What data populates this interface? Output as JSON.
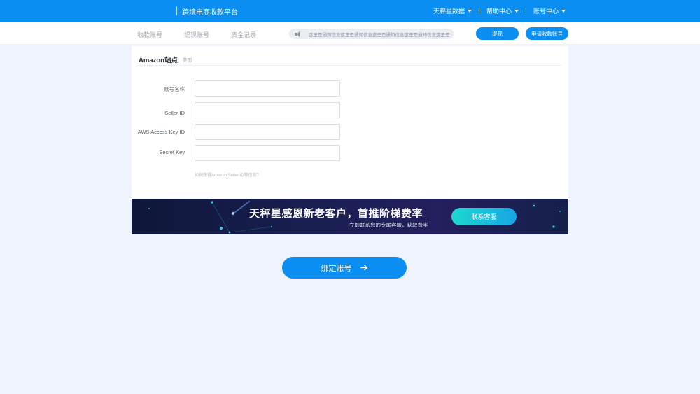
{
  "header": {
    "brand": "跨境电商收款平台",
    "nav": [
      {
        "label": "天秤星数据"
      },
      {
        "label": "帮助中心"
      },
      {
        "label": "账号中心"
      }
    ]
  },
  "subnav": {
    "tabs": [
      "收款账号",
      "提现账号",
      "资金记录"
    ],
    "notice": "这里是通知信息这里是通知信息这里是通知信息这里是通知信息这里是",
    "withdraw_label": "提现",
    "apply_label": "申请收款账号"
  },
  "form": {
    "title": "Amazon站点",
    "region": "美国",
    "fields": [
      {
        "label": "账号名称",
        "value": ""
      },
      {
        "label": "Seller ID",
        "value": ""
      },
      {
        "label": "AWS Access Key ID",
        "value": ""
      },
      {
        "label": "Secret Key",
        "value": ""
      }
    ],
    "help": "如何获得Amazon Seller ID等信息？"
  },
  "banner": {
    "title": "天秤星感恩新老客户，首推阶梯费率",
    "subtitle": "立即联系您的专属客服，获取费率",
    "button": "联系客服"
  },
  "submit": {
    "label": "绑定账号"
  },
  "colors": {
    "primary": "#0a8ef2",
    "background": "#eef3fc"
  }
}
